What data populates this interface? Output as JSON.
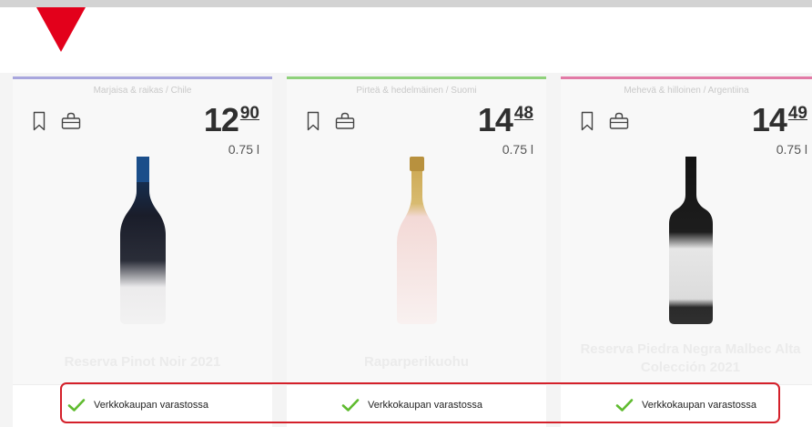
{
  "indicator": {
    "color": "#e3001b"
  },
  "highlight": {
    "color": "#d4202a"
  },
  "products": [
    {
      "taste": "Marjaisa & raikas / Chile",
      "accent": "#a8a6dd",
      "price_main": "12",
      "price_cents": "90",
      "volume": "0.75 l",
      "name": "Reserva Pinot Noir 2021",
      "stock_status": "Verkkokaupan varastossa",
      "bookmark_icon": "bookmark-icon",
      "basket_icon": "basket-icon",
      "check_icon": "check-icon"
    },
    {
      "taste": "Pirteä & hedelmäinen / Suomi",
      "accent": "#8fd17b",
      "price_main": "14",
      "price_cents": "48",
      "volume": "0.75 l",
      "name": "Raparperikuohu",
      "stock_status": "Verkkokaupan varastossa",
      "bookmark_icon": "bookmark-icon",
      "basket_icon": "basket-icon",
      "check_icon": "check-icon"
    },
    {
      "taste": "Mehevä & hilloinen / Argentiina",
      "accent": "#e27aa6",
      "price_main": "14",
      "price_cents": "49",
      "volume": "0.75 l",
      "name": "Reserva Piedra Negra Malbec Alta Colección 2021",
      "stock_status": "Verkkokaupan varastossa",
      "bookmark_icon": "bookmark-icon",
      "basket_icon": "basket-icon",
      "check_icon": "check-icon"
    }
  ]
}
